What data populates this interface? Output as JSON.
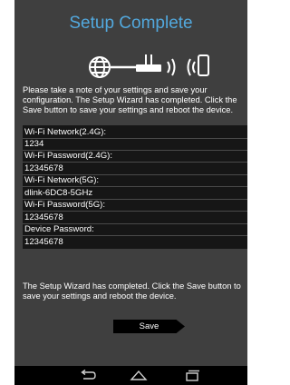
{
  "title": "Setup Complete",
  "graphic": {
    "icons": [
      "globe-icon",
      "router-icon",
      "wifi-waves-icon",
      "phone-icon"
    ]
  },
  "instruction": "Please take a note of your settings and save your configuration. The Setup Wizard has completed. Click the Save button to save your settings and reboot the device.",
  "settings": [
    {
      "label": "Wi-Fi Network(2.4G):",
      "value": "1234"
    },
    {
      "label": "Wi-Fi Password(2.4G):",
      "value": "12345678"
    },
    {
      "label": "Wi-Fi Network(5G):",
      "value": "dlink-6DC8-5GHz"
    },
    {
      "label": "Wi-Fi Password(5G):",
      "value": "12345678"
    },
    {
      "label": "Device Password:",
      "value": "12345678"
    }
  ],
  "completion_text": "The Setup Wizard has completed. Click the Save button to save your settings and reboot the device.",
  "save_label": "Save",
  "nav": {
    "buttons": [
      "back-icon",
      "home-icon",
      "recent-apps-icon"
    ]
  },
  "colors": {
    "background": "#3f3f3f",
    "title": "#52a8dd",
    "settings_box": "#161616",
    "nav_bar": "#000000"
  }
}
